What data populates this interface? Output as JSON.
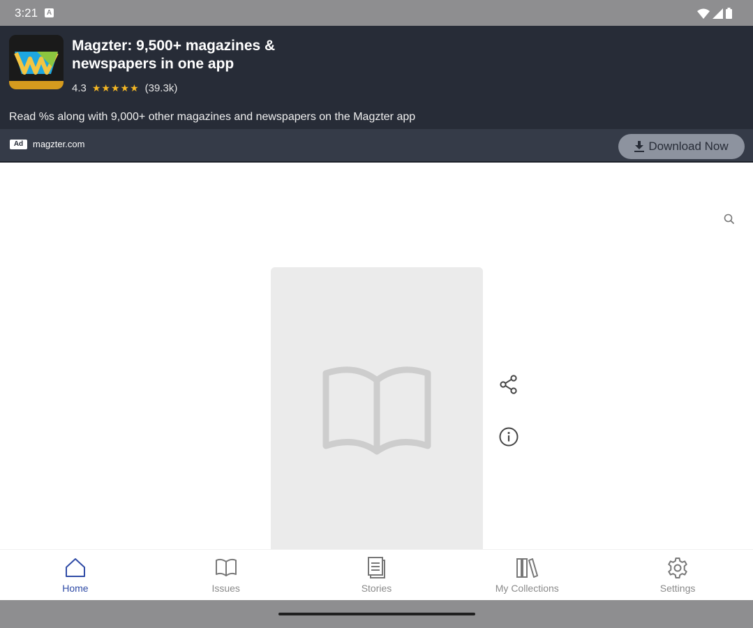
{
  "status_bar": {
    "time": "3:21",
    "notification_icon": "A",
    "icons": [
      "wifi-icon",
      "signal-icon",
      "battery-icon"
    ]
  },
  "ad": {
    "title": "Magzter: 9,500+ magazines & newspapers in one app",
    "rating": "4.3",
    "stars": "★★★★★",
    "review_count": "(39.3k)",
    "description": "Read %s along with 9,000+ other magazines and newspapers on the Magzter app",
    "ad_label": "Ad",
    "domain": "magzter.com",
    "cta_label": "Download Now",
    "colors": {
      "background": "#272c37",
      "footer": "#353b48",
      "stars": "#f6b824"
    }
  },
  "nav": {
    "items": [
      {
        "label": "Home",
        "icon": "home-icon",
        "active": true
      },
      {
        "label": "Issues",
        "icon": "book-icon",
        "active": false
      },
      {
        "label": "Stories",
        "icon": "document-icon",
        "active": false
      },
      {
        "label": "My Collections",
        "icon": "library-icon",
        "active": false
      },
      {
        "label": "Settings",
        "icon": "gear-icon",
        "active": false
      }
    ],
    "active_color": "#2f4ba6"
  }
}
